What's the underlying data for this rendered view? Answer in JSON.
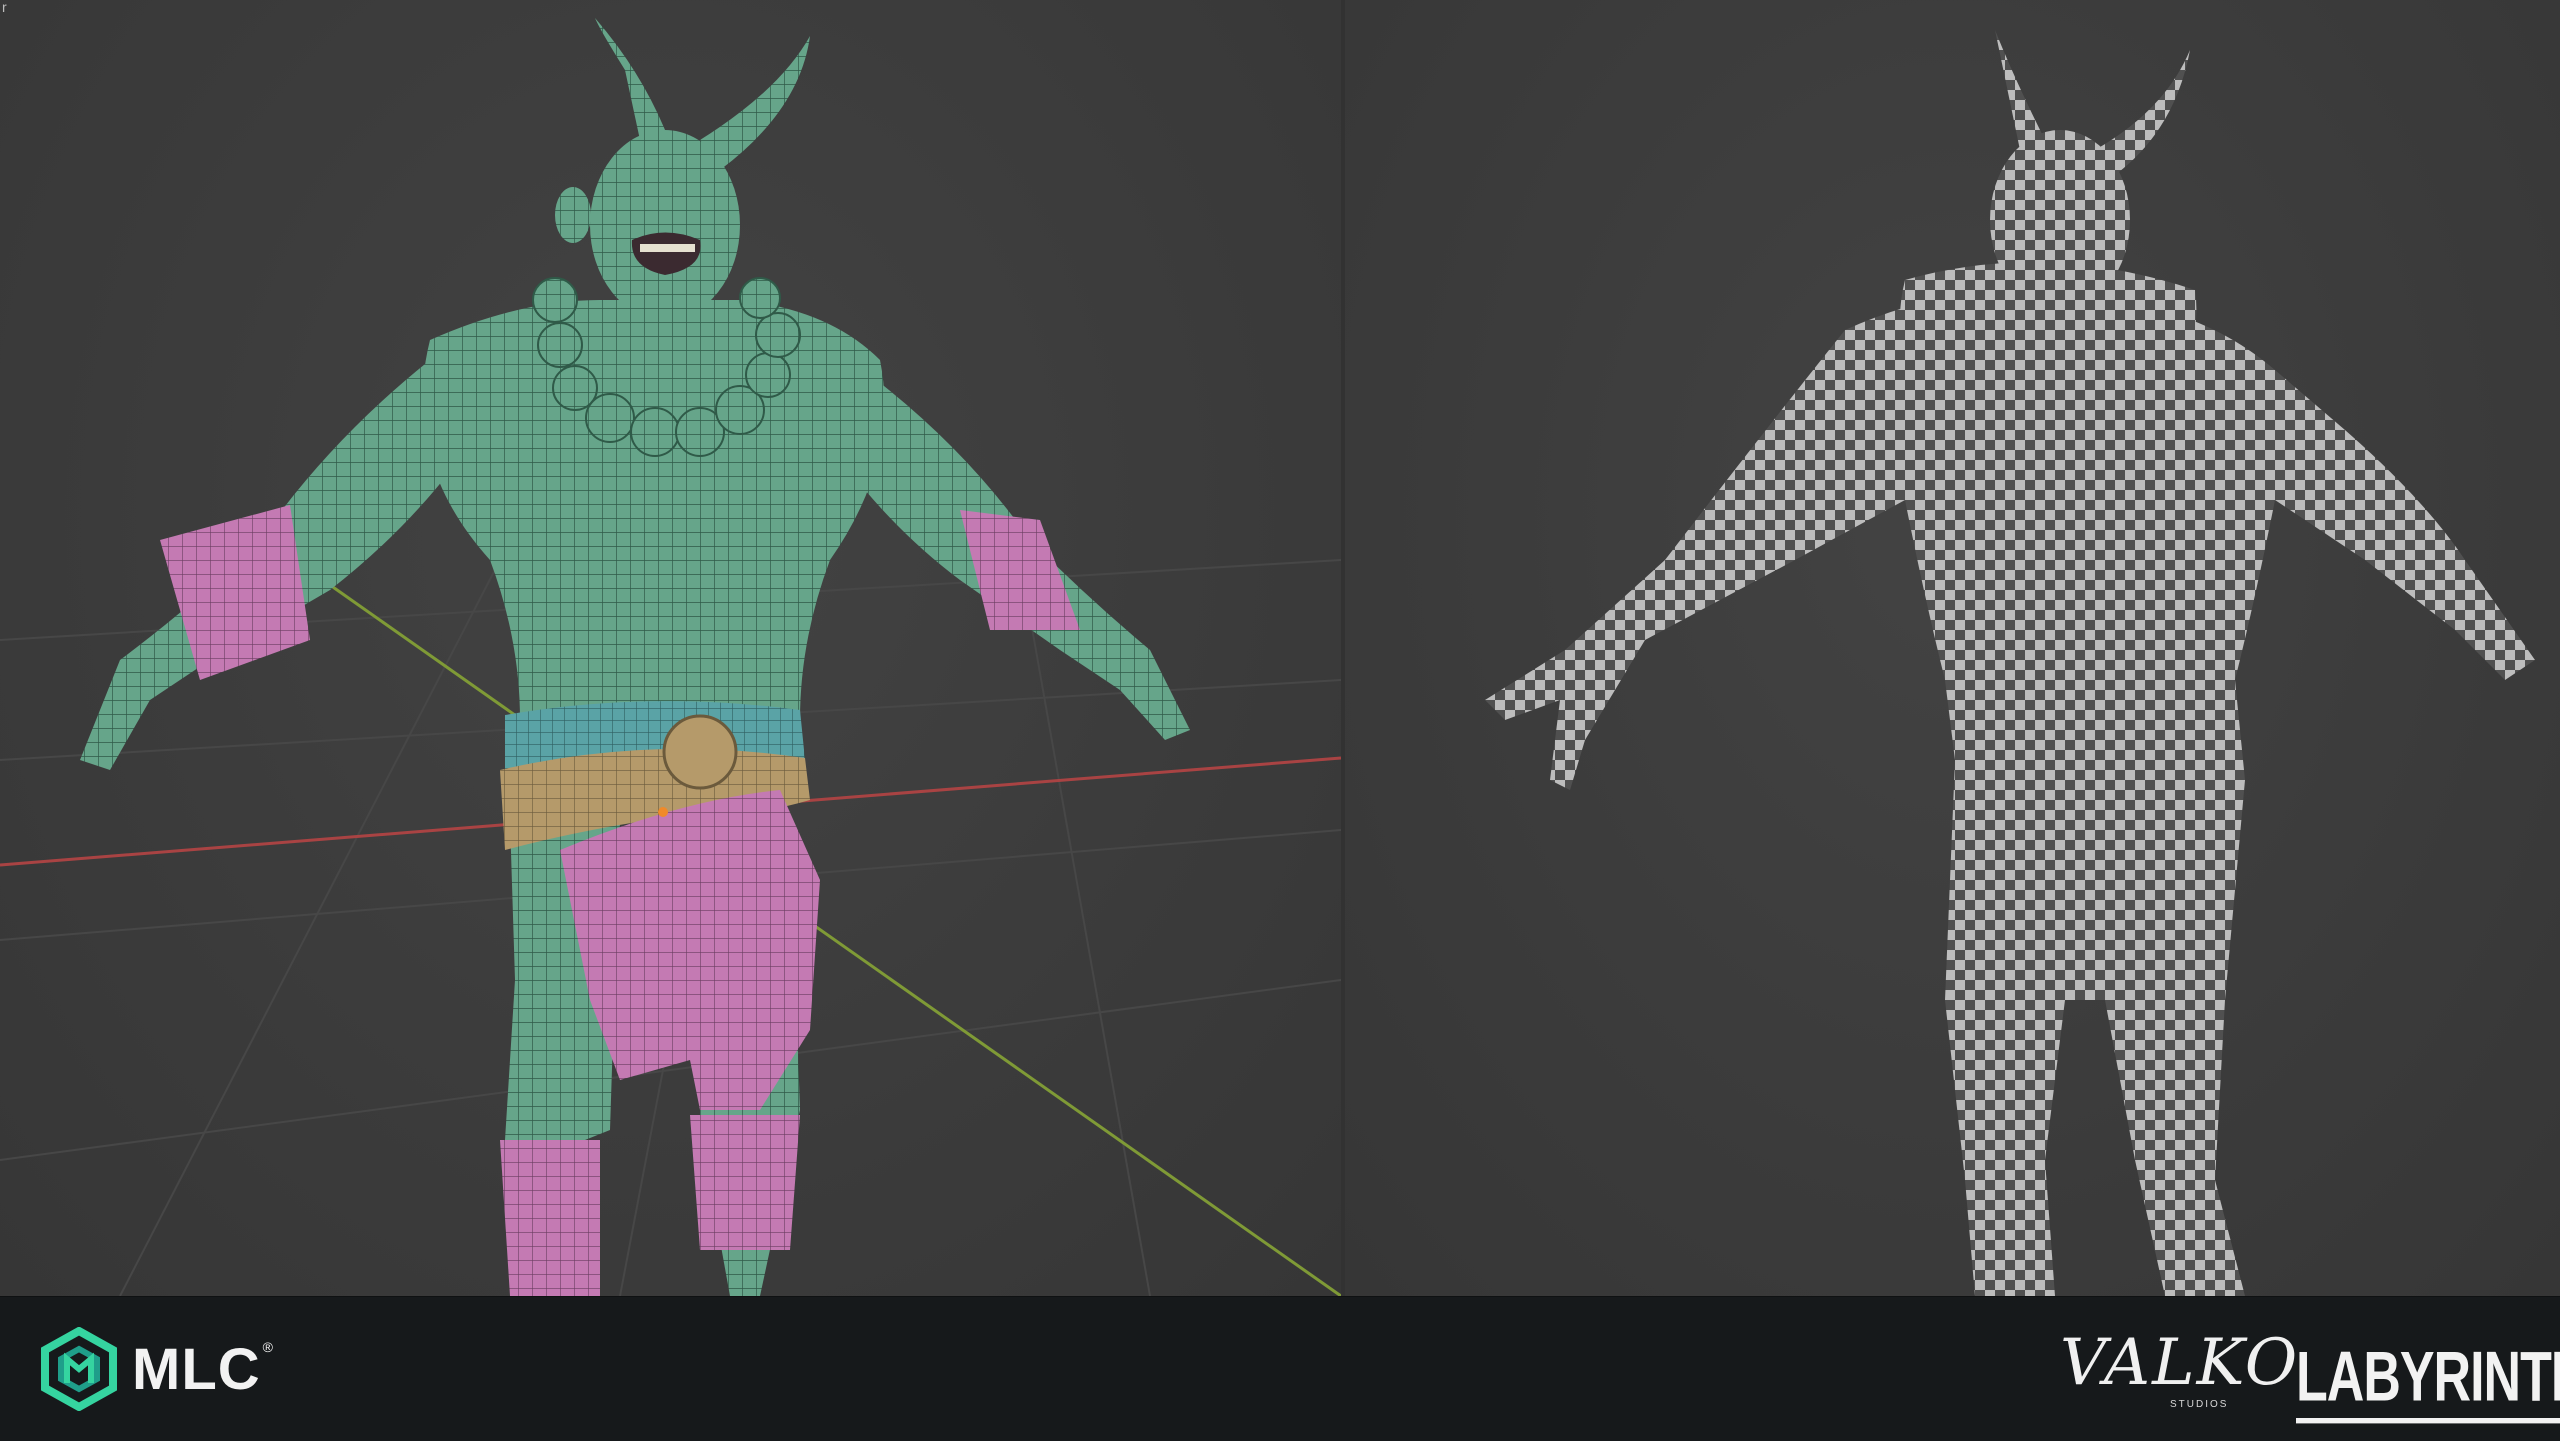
{
  "viewports": {
    "left": {
      "shading": "wireframe-solid"
    },
    "right": {
      "shading": "uv-checker"
    }
  },
  "corner_glyph": "r",
  "colors": {
    "skin": "#66a58a",
    "skin_wire": "#2f5a48",
    "cloth": "#c47ab3",
    "belt": "#b59a6a",
    "belt_band": "#5aa3a6",
    "axis_x": "#a94343",
    "axis_y": "#7f9a36",
    "grid": "#474747",
    "footer": "#16191b",
    "checker_dark": "#505050",
    "checker_light": "#bdbdbd"
  },
  "footer": {
    "mlc_logo_icon": "mlc-hexagon-icon",
    "mlc_label": "MLC",
    "mlc_registered": "®",
    "valko_label": "VALKO",
    "valko_sub": "STUDIOS",
    "labyrinthine_label": "LABYRINTHINE"
  }
}
